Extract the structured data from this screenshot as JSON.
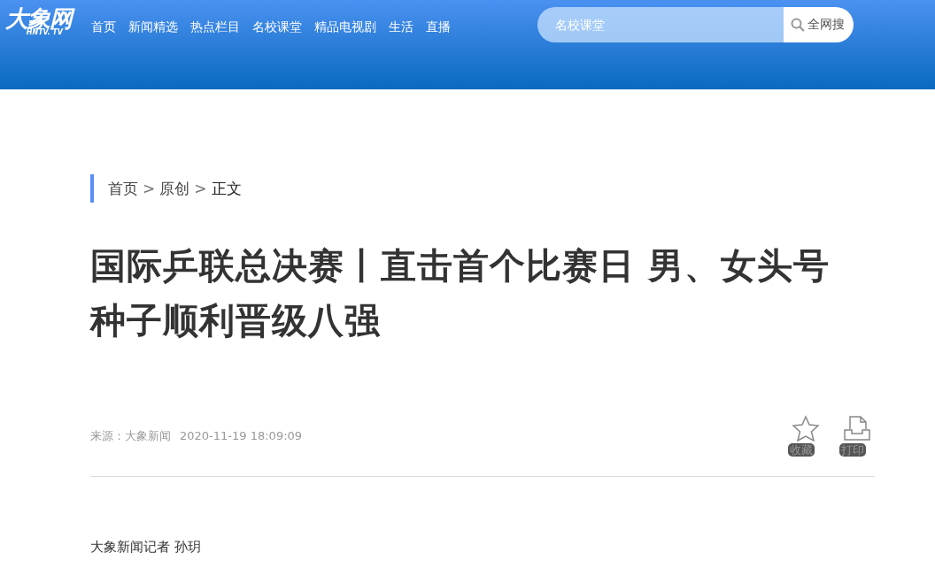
{
  "header": {
    "logo": {
      "text": "大象网",
      "subtext": "HNTV. TV"
    },
    "nav": [
      {
        "label": "首页"
      },
      {
        "label": "新闻精选"
      },
      {
        "label": "热点栏目"
      },
      {
        "label": "名校课堂"
      },
      {
        "label": "精品电视剧"
      },
      {
        "label": "生活"
      },
      {
        "label": "直播"
      }
    ],
    "search": {
      "placeholder": "名校课堂",
      "button": "全网搜"
    }
  },
  "breadcrumb": [
    {
      "kind": "link",
      "text": "首页"
    },
    {
      "kind": "separator",
      "text": ">"
    },
    {
      "kind": "link",
      "text": "原创"
    },
    {
      "kind": "separator",
      "text": ">"
    },
    {
      "kind": "current",
      "text": "正文"
    }
  ],
  "article": {
    "title": "国际乒联总决赛丨直击首个比赛日 男、女头号种子顺利晋级八强",
    "source": "来源：大象新闻",
    "date": "2020-11-19 18:09:09",
    "actions": [
      {
        "kind": "favorite",
        "label": "收藏"
      },
      {
        "kind": "print",
        "label": "打印"
      }
    ],
    "byline": "大象新闻记者 孙玥"
  }
}
